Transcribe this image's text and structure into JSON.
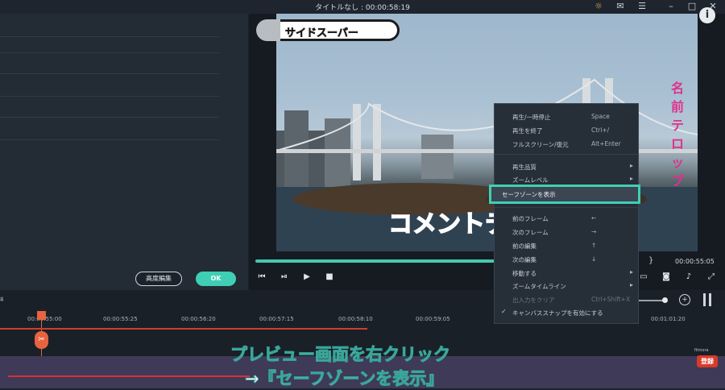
{
  "window": {
    "title": "タイトルなし : 00:00:58:19"
  },
  "left_panel": {
    "advanced_edit_label": "高度編集",
    "ok_label": "OK"
  },
  "preview": {
    "caption_side": "サイドスーパー",
    "caption_name": [
      "名",
      "前",
      "テ",
      "ロ",
      "ッ",
      "プ"
    ],
    "caption_comment": "コメントテ",
    "progress": 0.52,
    "current_time": "00:00:55:05",
    "brace": "}"
  },
  "context_menu": {
    "items": [
      {
        "label": "再生/一時停止",
        "shortcut": "Space"
      },
      {
        "label": "再生を終了",
        "shortcut": "Ctrl+/"
      },
      {
        "label": "フルスクリーン/復元",
        "shortcut": "Alt+Enter"
      },
      {
        "label": "再生品質",
        "shortcut": "",
        "arrow": "▸"
      },
      {
        "label": "ズームレベル",
        "shortcut": "",
        "arrow": "▸"
      },
      {
        "label": "セーフゾーンを表示",
        "shortcut": "",
        "highlight": true
      },
      {
        "label": "前のフレーム",
        "shortcut": "←"
      },
      {
        "label": "次のフレーム",
        "shortcut": "→"
      },
      {
        "label": "前の編集",
        "shortcut": "↑"
      },
      {
        "label": "次の編集",
        "shortcut": "↓"
      },
      {
        "label": "移動する",
        "shortcut": "",
        "arrow": "▸"
      },
      {
        "label": "ズームタイムライン",
        "shortcut": "",
        "arrow": "▸"
      },
      {
        "label": "出入力をクリア",
        "shortcut": "Ctrl+Shift+X",
        "disabled": true
      },
      {
        "label": "キャンバススナップを有効にする",
        "shortcut": "",
        "check": "✓"
      }
    ]
  },
  "timeline": {
    "ticks": [
      "00:00:55:00",
      "00:00:55:25",
      "00:00:56:20",
      "00:00:57:15",
      "00:00:58:10",
      "00:00:59:05",
      "00:01:01:20"
    ],
    "subscribe_label": "登録",
    "brand": "filmora"
  },
  "annotation": {
    "line1": "プレビュー画面を右クリック",
    "line2": "→『セーフゾーンを表示』"
  }
}
